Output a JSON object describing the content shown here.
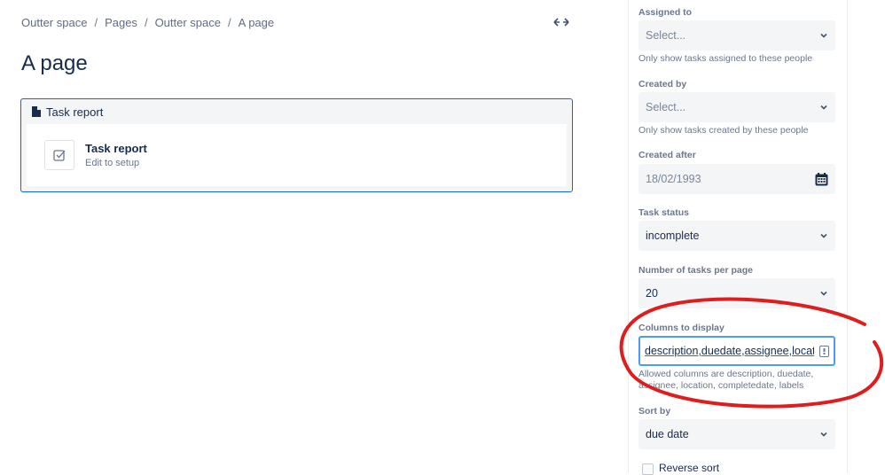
{
  "breadcrumb": [
    "Outter space",
    "Pages",
    "Outter space",
    "A page"
  ],
  "page_title": "A page",
  "macro": {
    "header": "Task report",
    "title": "Task report",
    "subtitle": "Edit to setup"
  },
  "panel": {
    "assigned_to": {
      "label": "Assigned to",
      "placeholder": "Select...",
      "hint": "Only show tasks assigned to these people"
    },
    "created_by": {
      "label": "Created by",
      "placeholder": "Select...",
      "hint": "Only show tasks created by these people"
    },
    "created_after": {
      "label": "Created after",
      "value": "18/02/1993"
    },
    "task_status": {
      "label": "Task status",
      "value": "incomplete"
    },
    "tasks_per_page": {
      "label": "Number of tasks per page",
      "value": "20"
    },
    "columns": {
      "label": "Columns to display",
      "value": "description,duedate,assignee,location",
      "hint": "Allowed columns are description, duedate, assignee, location, completedate, labels"
    },
    "sort_by": {
      "label": "Sort by",
      "value": "due date"
    },
    "reverse_sort": {
      "label": "Reverse sort",
      "checked": false
    }
  },
  "colors": {
    "accent": "#0c66e4",
    "annotation": "#de1e1e",
    "field_bg": "#f4f5f7"
  }
}
